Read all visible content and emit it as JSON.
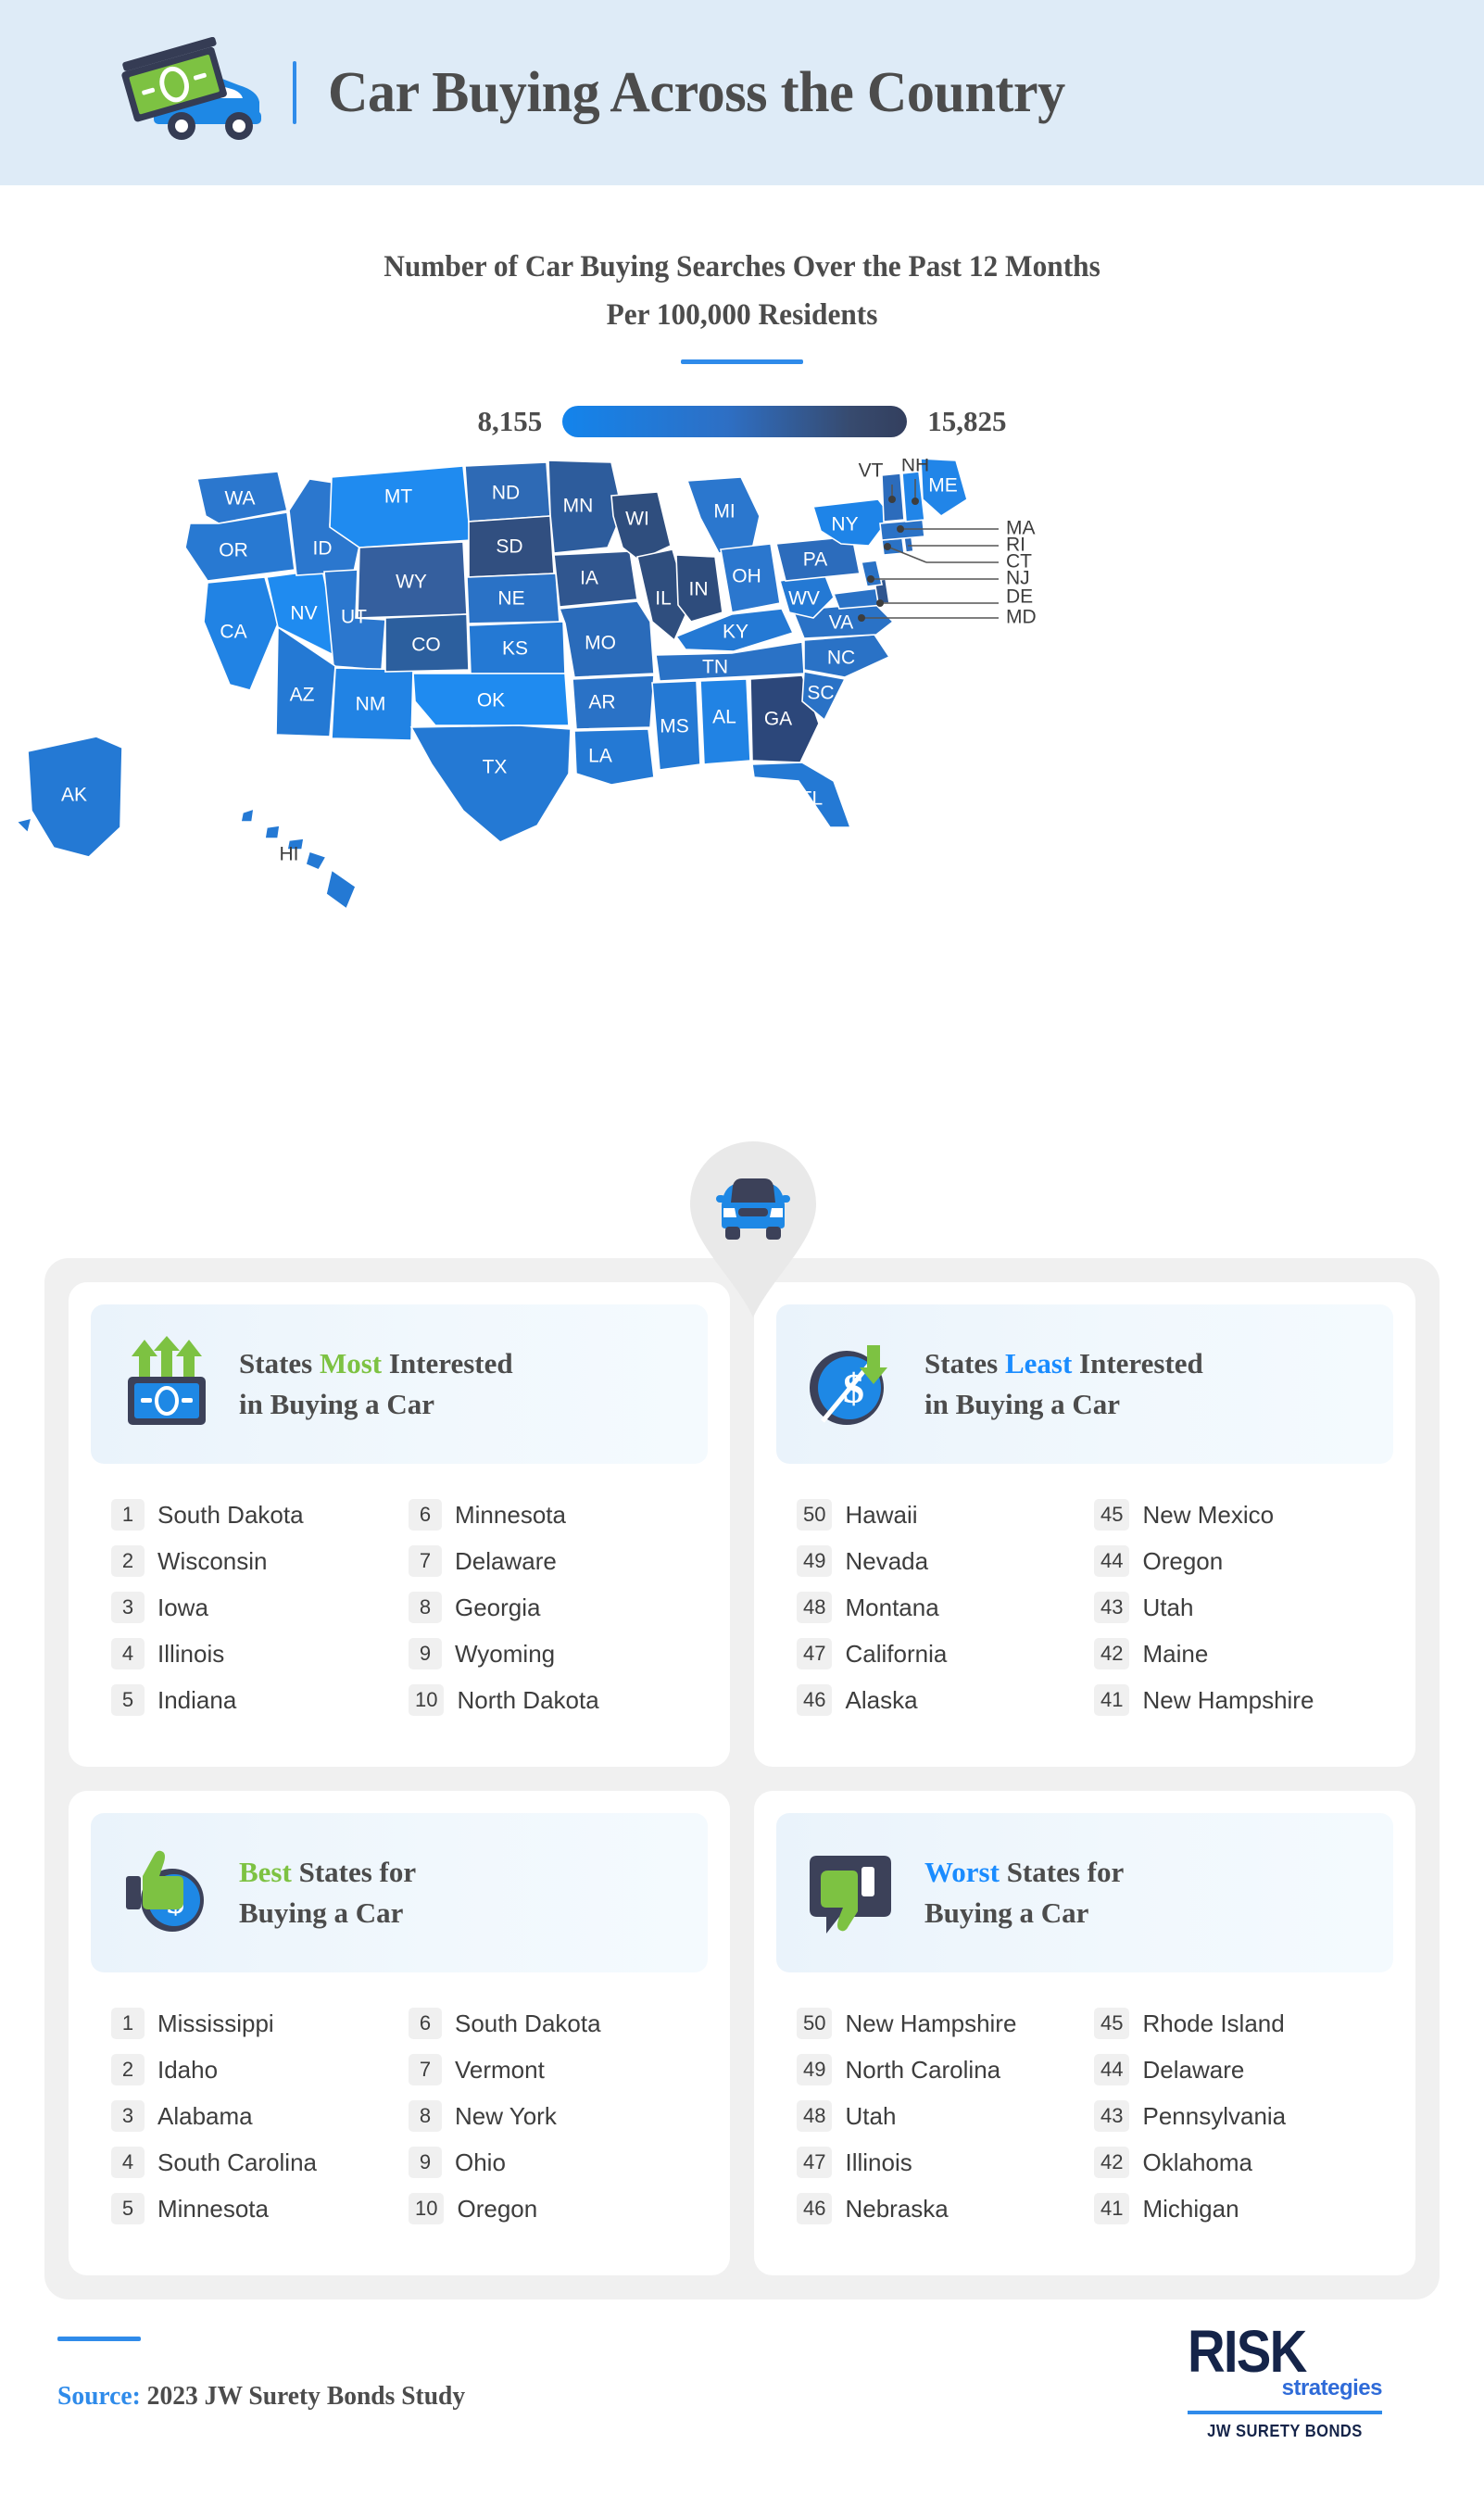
{
  "header": {
    "title": "Car Buying Across the Country",
    "icon": "car-with-money-icon"
  },
  "subtitle": {
    "line1": "Number of Car Buying Searches Over the Past 12 Months",
    "line2": "Per 100,000 Residents"
  },
  "legend": {
    "min": "8,155",
    "max": "15,825",
    "color_min": "#1384EC",
    "color_max": "#333F5E"
  },
  "map": {
    "pin_icon": "car-map-pin-icon",
    "callouts": [
      "NH",
      "VT",
      "MA",
      "RI",
      "CT",
      "NJ",
      "DE",
      "MD"
    ]
  },
  "chart_data": {
    "type": "heatmap",
    "title": "Number of Car Buying Searches Over the Past 12 Months Per 100,000 Residents",
    "subtitle": "Per 100,000 Residents",
    "legend_min": 8155,
    "legend_max": 15825,
    "unit": "searches per 100,000 residents",
    "colorscale": [
      "#1384EC",
      "#333F5E"
    ],
    "regions": [
      {
        "code": "WA",
        "name": "Washington",
        "shade": "#2B77CE"
      },
      {
        "code": "OR",
        "name": "Oregon",
        "shade": "#2879D2"
      },
      {
        "code": "ID",
        "name": "Idaho",
        "shade": "#2B77CE"
      },
      {
        "code": "MT",
        "name": "Montana",
        "shade": "#1F8BF0"
      },
      {
        "code": "WY",
        "name": "Wyoming",
        "shade": "#355F9E"
      },
      {
        "code": "ND",
        "name": "North Dakota",
        "shade": "#2E6AB5"
      },
      {
        "code": "SD",
        "name": "South Dakota",
        "shade": "#314F80"
      },
      {
        "code": "NE",
        "name": "Nebraska",
        "shade": "#2A72C6"
      },
      {
        "code": "MN",
        "name": "Minnesota",
        "shade": "#2D5C9C"
      },
      {
        "code": "IA",
        "name": "Iowa",
        "shade": "#30568F"
      },
      {
        "code": "WI",
        "name": "Wisconsin",
        "shade": "#2F4E7E"
      },
      {
        "code": "IL",
        "name": "Illinois",
        "shade": "#2F4E7E"
      },
      {
        "code": "IN",
        "name": "Indiana",
        "shade": "#2E4C7C"
      },
      {
        "code": "MI",
        "name": "Michigan",
        "shade": "#2B77CE"
      },
      {
        "code": "OH",
        "name": "Ohio",
        "shade": "#2B77CE"
      },
      {
        "code": "PA",
        "name": "Pennsylvania",
        "shade": "#2C6CBC"
      },
      {
        "code": "NY",
        "name": "New York",
        "shade": "#1E84E8"
      },
      {
        "code": "ME",
        "name": "Maine",
        "shade": "#2185E8"
      },
      {
        "code": "VT",
        "name": "Vermont",
        "shade": "#2C6CBC"
      },
      {
        "code": "NH",
        "name": "New Hampshire",
        "shade": "#2185E8"
      },
      {
        "code": "MA",
        "name": "Massachusetts",
        "shade": "#2A72C6"
      },
      {
        "code": "RI",
        "name": "Rhode Island",
        "shade": "#2C6CBC"
      },
      {
        "code": "CT",
        "name": "Connecticut",
        "shade": "#2A72C6"
      },
      {
        "code": "NJ",
        "name": "New Jersey",
        "shade": "#2A72C6"
      },
      {
        "code": "DE",
        "name": "Delaware",
        "shade": "#30568F"
      },
      {
        "code": "MD",
        "name": "Maryland",
        "shade": "#2A72C6"
      },
      {
        "code": "WV",
        "name": "West Virginia",
        "shade": "#2479D4"
      },
      {
        "code": "VA",
        "name": "Virginia",
        "shade": "#2A72C6"
      },
      {
        "code": "NC",
        "name": "North Carolina",
        "shade": "#2A72C6"
      },
      {
        "code": "SC",
        "name": "South Carolina",
        "shade": "#2A72C6"
      },
      {
        "code": "GA",
        "name": "Georgia",
        "shade": "#2C477A"
      },
      {
        "code": "FL",
        "name": "Florida",
        "shade": "#2479D4"
      },
      {
        "code": "AL",
        "name": "Alabama",
        "shade": "#2183E4"
      },
      {
        "code": "MS",
        "name": "Mississippi",
        "shade": "#2479D4"
      },
      {
        "code": "TN",
        "name": "Tennessee",
        "shade": "#2A72C6"
      },
      {
        "code": "KY",
        "name": "Kentucky",
        "shade": "#2479D4"
      },
      {
        "code": "MO",
        "name": "Missouri",
        "shade": "#2A6BBA"
      },
      {
        "code": "AR",
        "name": "Arkansas",
        "shade": "#2A72C6"
      },
      {
        "code": "LA",
        "name": "Louisiana",
        "shade": "#2479D4"
      },
      {
        "code": "OK",
        "name": "Oklahoma",
        "shade": "#1F8BF0"
      },
      {
        "code": "KS",
        "name": "Kansas",
        "shade": "#2479D4"
      },
      {
        "code": "TX",
        "name": "Texas",
        "shade": "#2479D4"
      },
      {
        "code": "NM",
        "name": "New Mexico",
        "shade": "#2183E4"
      },
      {
        "code": "CO",
        "name": "Colorado",
        "shade": "#2C5F9E"
      },
      {
        "code": "UT",
        "name": "Utah",
        "shade": "#2B77CE"
      },
      {
        "code": "AZ",
        "name": "Arizona",
        "shade": "#2479D4"
      },
      {
        "code": "NV",
        "name": "Nevada",
        "shade": "#1F8BF0"
      },
      {
        "code": "CA",
        "name": "California",
        "shade": "#2183E4"
      },
      {
        "code": "AK",
        "name": "Alaska",
        "shade": "#2479D4"
      },
      {
        "code": "HI",
        "name": "Hawaii",
        "shade": "#2479D4"
      }
    ]
  },
  "cards": [
    {
      "icon": "money-up-arrows-icon",
      "title_pre": "States ",
      "title_hl": "Most",
      "title_post": " Interested",
      "title_line2": "in Buying a Car",
      "highlight_color": "#7DC242",
      "items": [
        {
          "rank": "1",
          "name": "South Dakota"
        },
        {
          "rank": "2",
          "name": "Wisconsin"
        },
        {
          "rank": "3",
          "name": "Iowa"
        },
        {
          "rank": "4",
          "name": "Illinois"
        },
        {
          "rank": "5",
          "name": "Indiana"
        },
        {
          "rank": "6",
          "name": "Minnesota"
        },
        {
          "rank": "7",
          "name": "Delaware"
        },
        {
          "rank": "8",
          "name": "Georgia"
        },
        {
          "rank": "9",
          "name": "Wyoming"
        },
        {
          "rank": "10",
          "name": "North Dakota"
        }
      ]
    },
    {
      "icon": "dollar-circle-down-arrow-icon",
      "title_pre": "States ",
      "title_hl": "Least",
      "title_post": " Interested",
      "title_line2": "in Buying a Car",
      "highlight_color": "#1A8CFF",
      "items": [
        {
          "rank": "50",
          "name": "Hawaii"
        },
        {
          "rank": "49",
          "name": "Nevada"
        },
        {
          "rank": "48",
          "name": "Montana"
        },
        {
          "rank": "47",
          "name": "California"
        },
        {
          "rank": "46",
          "name": "Alaska"
        },
        {
          "rank": "45",
          "name": "New Mexico"
        },
        {
          "rank": "44",
          "name": "Oregon"
        },
        {
          "rank": "43",
          "name": "Utah"
        },
        {
          "rank": "42",
          "name": "Maine"
        },
        {
          "rank": "41",
          "name": "New Hampshire"
        }
      ]
    },
    {
      "icon": "thumbs-up-dollar-icon",
      "title_pre": "",
      "title_hl": "Best",
      "title_post": " States for",
      "title_line2": "Buying a Car",
      "highlight_color": "#7DC242",
      "items": [
        {
          "rank": "1",
          "name": "Mississippi"
        },
        {
          "rank": "2",
          "name": "Idaho"
        },
        {
          "rank": "3",
          "name": "Alabama"
        },
        {
          "rank": "4",
          "name": "South Carolina"
        },
        {
          "rank": "5",
          "name": "Minnesota"
        },
        {
          "rank": "6",
          "name": "South Dakota"
        },
        {
          "rank": "7",
          "name": "Vermont"
        },
        {
          "rank": "8",
          "name": "New York"
        },
        {
          "rank": "9",
          "name": "Ohio"
        },
        {
          "rank": "10",
          "name": "Oregon"
        }
      ]
    },
    {
      "icon": "thumbs-down-speech-bubble-icon",
      "title_pre": "",
      "title_hl": "Worst",
      "title_post": " States for",
      "title_line2": "Buying a Car",
      "highlight_color": "#1A8CFF",
      "items": [
        {
          "rank": "50",
          "name": "New Hampshire"
        },
        {
          "rank": "49",
          "name": "North Carolina"
        },
        {
          "rank": "48",
          "name": "Utah"
        },
        {
          "rank": "47",
          "name": "Illinois"
        },
        {
          "rank": "46",
          "name": "Nebraska"
        },
        {
          "rank": "45",
          "name": "Rhode Island"
        },
        {
          "rank": "44",
          "name": "Delaware"
        },
        {
          "rank": "43",
          "name": "Pennsylvania"
        },
        {
          "rank": "42",
          "name": "Oklahoma"
        },
        {
          "rank": "41",
          "name": "Michigan"
        }
      ]
    }
  ],
  "footer": {
    "source_label": "Source:",
    "source_text": " 2023 JW Surety Bonds Study",
    "logo_risk": "RISK",
    "logo_strategies": "strategies",
    "logo_jw": "JW SURETY BONDS"
  }
}
